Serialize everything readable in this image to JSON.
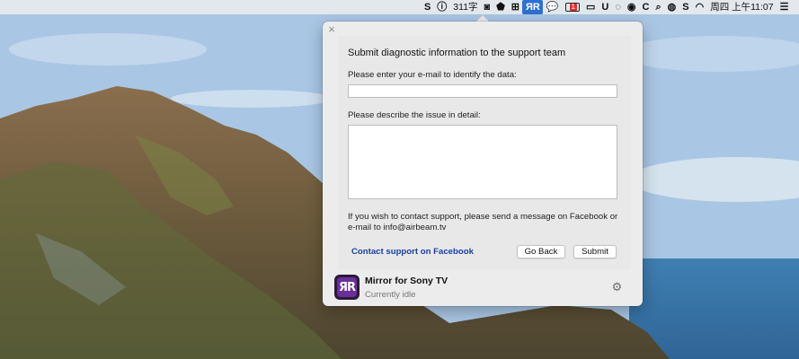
{
  "menubar": {
    "items": [
      {
        "icon": "s-app-icon",
        "glyph": "S"
      },
      {
        "icon": "info-circle-icon",
        "glyph": "ⓘ"
      },
      {
        "label": "311字"
      },
      {
        "icon": "clipboard-icon",
        "glyph": "◙"
      },
      {
        "icon": "shield-b-icon",
        "glyph": "⬟"
      },
      {
        "icon": "grid-app-icon",
        "glyph": "⊞"
      },
      {
        "icon": "airbeam-icon",
        "glyph": "ЯR"
      },
      {
        "icon": "wechat-icon",
        "glyph": "💬"
      },
      {
        "icon": "battery-alert-icon",
        "badge": "1"
      },
      {
        "icon": "video-icon",
        "glyph": "▭"
      },
      {
        "icon": "shield-u-icon",
        "glyph": "U"
      },
      {
        "icon": "chat-bubble-icon",
        "glyph": "◌"
      },
      {
        "icon": "eye-icon",
        "glyph": "◉"
      },
      {
        "icon": "c-app-icon",
        "glyph": "C"
      },
      {
        "icon": "search-icon",
        "glyph": "⌕"
      },
      {
        "icon": "globe-icon",
        "glyph": "◍"
      },
      {
        "icon": "s-box-icon",
        "glyph": "S"
      },
      {
        "icon": "wifi-icon",
        "glyph": "◠"
      },
      {
        "label": "周四 上午11:07"
      },
      {
        "icon": "list-menu-icon",
        "glyph": "☰"
      }
    ]
  },
  "dialog": {
    "close_glyph": "×",
    "title": "Submit diagnostic information to the support team",
    "email_label": "Please enter your e-mail to identify the data:",
    "email_value": "",
    "issue_label": "Please describe the issue in detail:",
    "issue_value": "",
    "hint": "If you wish to contact support, please send a message on Facebook or e-mail to info@airbeam.tv",
    "facebook_link": "Contact support on Facebook",
    "back_button": "Go Back",
    "submit_button": "Submit"
  },
  "app": {
    "icon_glyph": "ЯR",
    "name": "Mirror for Sony TV",
    "status": "Currently idle",
    "gear_glyph": "⚙"
  },
  "colors": {
    "accent_link": "#1a3fa0",
    "menubar_active": "#2f6fd1",
    "app_icon_bg": "#6b2f9b"
  }
}
